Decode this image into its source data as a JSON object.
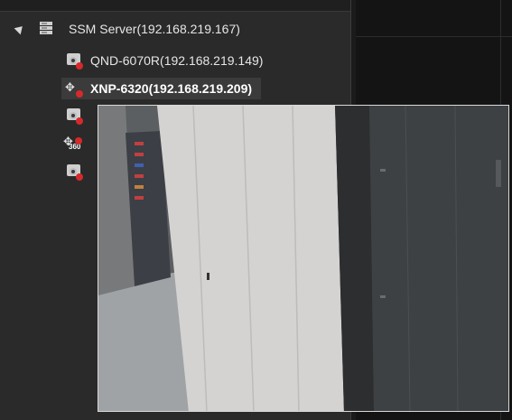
{
  "tree": {
    "server_label": "SSM Server(192.168.219.167)",
    "cameras": [
      {
        "label": "QND-6070R(192.168.219.149)",
        "icon": "camera-icon"
      },
      {
        "label": "XNP-6320(192.168.219.209)",
        "icon": "ptz-camera-icon",
        "selected": true
      },
      {
        "label": "",
        "icon": "camera-icon"
      },
      {
        "label": "",
        "icon": "ptz-360-camera-icon",
        "badge": "360"
      },
      {
        "label": "",
        "icon": "camera-icon"
      }
    ]
  },
  "colors": {
    "panel_bg": "#2a2a2a",
    "selected_bg": "#3b3b3b",
    "status_red": "#d62a2a"
  }
}
